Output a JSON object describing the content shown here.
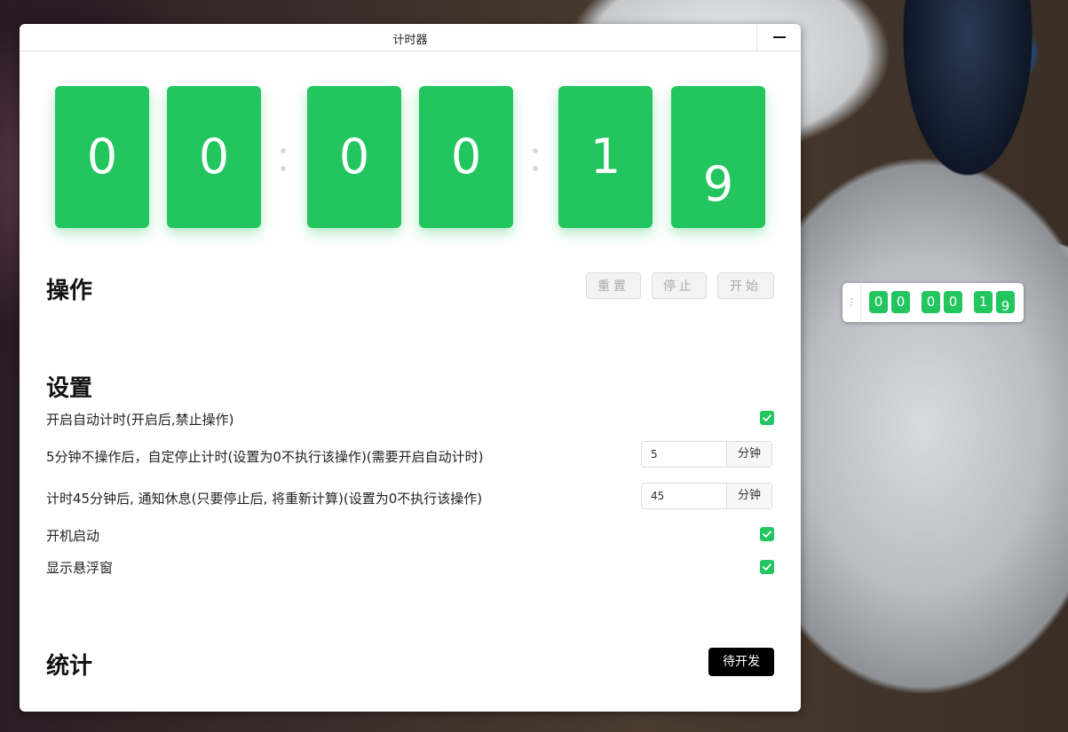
{
  "window": {
    "title": "计时器"
  },
  "timer": {
    "digits": [
      "0",
      "0",
      "0",
      "0",
      "1",
      "9"
    ]
  },
  "operations": {
    "heading": "操作",
    "reset_label": "重置",
    "stop_label": "停止",
    "start_label": "开始"
  },
  "settings": {
    "heading": "设置",
    "auto_timing": {
      "label": "开启自动计时(开启后,禁止操作)",
      "checked": true
    },
    "auto_stop": {
      "label": "5分钟不操作后，自定停止计时(设置为0不执行该操作)(需要开启自动计时)",
      "value": "5",
      "unit": "分钟"
    },
    "rest_notify": {
      "label": "计时45分钟后, 通知休息(只要停止后, 将重新计算)(设置为0不执行该操作)",
      "value": "45",
      "unit": "分钟"
    },
    "launch_on_boot": {
      "label": "开机启动",
      "checked": true
    },
    "show_floating": {
      "label": "显示悬浮窗",
      "checked": true
    }
  },
  "stats": {
    "heading": "统计",
    "dev_label": "待开发"
  },
  "floating_window": {
    "handle": "⋮",
    "digits": [
      "0",
      "0",
      "0",
      "0",
      "1",
      "9"
    ]
  },
  "colors": {
    "accent": "#22c55e",
    "dark_button": "#000000"
  }
}
